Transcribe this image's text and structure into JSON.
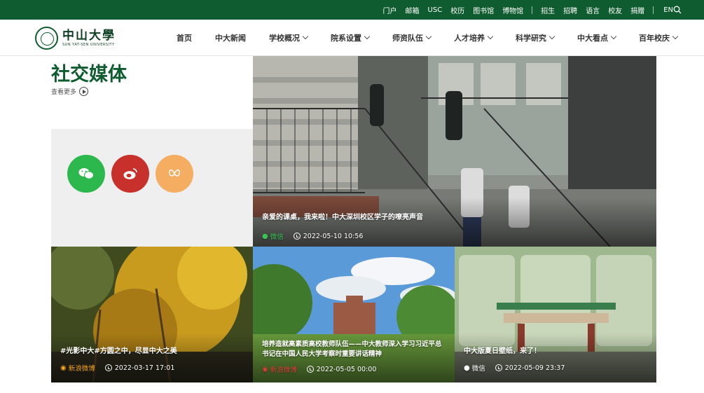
{
  "topbar": {
    "links": [
      "门户",
      "邮箱",
      "USC",
      "校历",
      "图书馆",
      "博物馆"
    ],
    "links2": [
      "招生",
      "招聘",
      "语言",
      "校友",
      "捐赠"
    ],
    "lang": "EN"
  },
  "logo": {
    "cn": "中山大學",
    "en": "SUN YAT-SEN UNIVERSITY"
  },
  "nav": [
    {
      "label": "首页",
      "dropdown": false
    },
    {
      "label": "中大新闻",
      "dropdown": false
    },
    {
      "label": "学校概况",
      "dropdown": true
    },
    {
      "label": "院系设置",
      "dropdown": true
    },
    {
      "label": "师资队伍",
      "dropdown": true
    },
    {
      "label": "人才培养",
      "dropdown": true
    },
    {
      "label": "科学研究",
      "dropdown": true
    },
    {
      "label": "中大看点",
      "dropdown": true
    },
    {
      "label": "百年校庆",
      "dropdown": true
    }
  ],
  "section": {
    "title": "社交媒体",
    "more": "查看更多"
  },
  "social": [
    {
      "name": "wechat",
      "color": "#2db84d"
    },
    {
      "name": "weibo",
      "color": "#c8312b"
    },
    {
      "name": "other",
      "color": "#f5ad62"
    }
  ],
  "posts": [
    {
      "caption": "亲爱的课桌，我来啦！中大深圳校区学子的嘹亮声音",
      "source": "微信",
      "time": "2022-05-10 10:56"
    },
    {
      "caption": "#光影中大#方圆之中，尽显中大之美",
      "source": "新浪微博",
      "time": "2022-03-17 17:01"
    },
    {
      "caption": "培养造就高素质高校教师队伍——中大教师深入学习习近平总书记在中国人民大学考察时重要讲话精神",
      "source": "新浪微博",
      "time": "2022-05-05 00:00"
    },
    {
      "caption": "中大版夏日壁纸，来了！",
      "source": "微信",
      "time": "2022-05-09 23:37"
    }
  ],
  "colors": {
    "brand": "#0e5c2f"
  }
}
